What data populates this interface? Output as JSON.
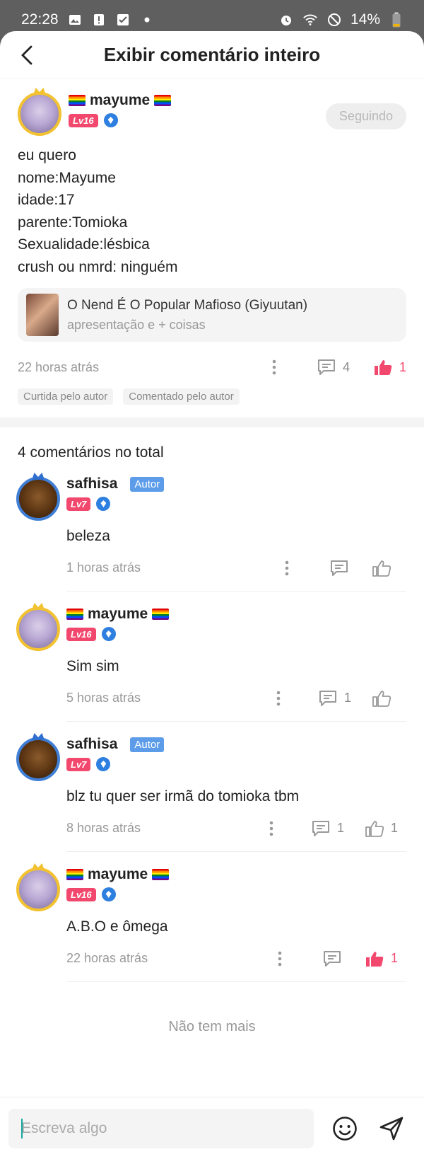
{
  "status_bar": {
    "time": "22:28",
    "battery": "14%"
  },
  "header": {
    "title": "Exibir comentário inteiro"
  },
  "main_comment": {
    "username": "mayume",
    "level": "Lv16",
    "follow_label": "Seguindo",
    "text": "eu quero\nnome:Mayume\nidade:17\nparente:Tomioka\nSexualidade:lésbica\ncrush ou nmrd: ninguém",
    "book": {
      "title": "O Nend É O Popular Mafioso (Giyuutan)",
      "subtitle": "apresentação e + coisas"
    },
    "time": "22 horas atrás",
    "replies_count": "4",
    "likes_count": "1",
    "tags": [
      "Curtida pelo autor",
      "Comentado pelo autor"
    ]
  },
  "total_label": "4 comentários no total",
  "replies": [
    {
      "username": "safhisa",
      "badge": "Autor",
      "level": "Lv7",
      "text": "beleza",
      "time": "1 horas atrás",
      "reply_count": "",
      "like_count": "",
      "liked": false
    },
    {
      "username": "mayume",
      "badge": "",
      "level": "Lv16",
      "text": "Sim sim",
      "time": "5 horas atrás",
      "reply_count": "1",
      "like_count": "",
      "liked": false
    },
    {
      "username": "safhisa",
      "badge": "Autor",
      "level": "Lv7",
      "text": "blz tu quer ser irmã do tomioka tbm",
      "time": "8 horas atrás",
      "reply_count": "1",
      "like_count": "1",
      "liked": false
    },
    {
      "username": "mayume",
      "badge": "",
      "level": "Lv16",
      "text": "A.B.O  e ômega",
      "time": "22 horas atrás",
      "reply_count": "",
      "like_count": "1",
      "liked": true
    }
  ],
  "no_more_label": "Não tem mais",
  "composer": {
    "placeholder": "Escreva algo"
  },
  "colors": {
    "accent_like": "#f2486d",
    "level_badge": "#f2486d",
    "author_badge": "#5c9ce8",
    "status_bar": "#5f5f5f"
  },
  "icons": [
    "back-arrow-icon",
    "dots-menu-icon",
    "comment-icon",
    "thumbs-up-icon",
    "emoji-icon",
    "send-icon",
    "image-icon",
    "alarm-icon",
    "wifi-icon",
    "battery-icon"
  ]
}
